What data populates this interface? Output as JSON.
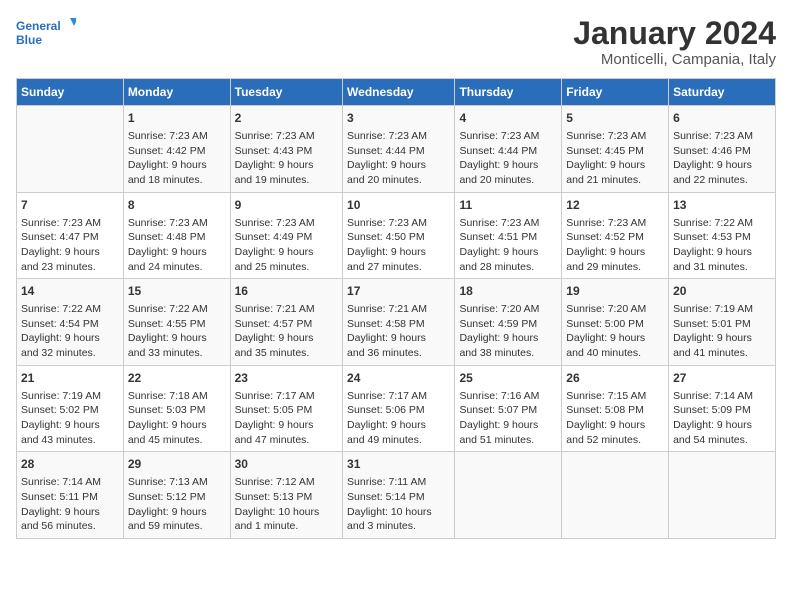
{
  "logo": {
    "line1": "General",
    "line2": "Blue"
  },
  "title": "January 2024",
  "subtitle": "Monticelli, Campania, Italy",
  "days_header": [
    "Sunday",
    "Monday",
    "Tuesday",
    "Wednesday",
    "Thursday",
    "Friday",
    "Saturday"
  ],
  "weeks": [
    [
      {
        "day": "",
        "info": ""
      },
      {
        "day": "1",
        "info": "Sunrise: 7:23 AM\nSunset: 4:42 PM\nDaylight: 9 hours\nand 18 minutes."
      },
      {
        "day": "2",
        "info": "Sunrise: 7:23 AM\nSunset: 4:43 PM\nDaylight: 9 hours\nand 19 minutes."
      },
      {
        "day": "3",
        "info": "Sunrise: 7:23 AM\nSunset: 4:44 PM\nDaylight: 9 hours\nand 20 minutes."
      },
      {
        "day": "4",
        "info": "Sunrise: 7:23 AM\nSunset: 4:44 PM\nDaylight: 9 hours\nand 20 minutes."
      },
      {
        "day": "5",
        "info": "Sunrise: 7:23 AM\nSunset: 4:45 PM\nDaylight: 9 hours\nand 21 minutes."
      },
      {
        "day": "6",
        "info": "Sunrise: 7:23 AM\nSunset: 4:46 PM\nDaylight: 9 hours\nand 22 minutes."
      }
    ],
    [
      {
        "day": "7",
        "info": "Sunrise: 7:23 AM\nSunset: 4:47 PM\nDaylight: 9 hours\nand 23 minutes."
      },
      {
        "day": "8",
        "info": "Sunrise: 7:23 AM\nSunset: 4:48 PM\nDaylight: 9 hours\nand 24 minutes."
      },
      {
        "day": "9",
        "info": "Sunrise: 7:23 AM\nSunset: 4:49 PM\nDaylight: 9 hours\nand 25 minutes."
      },
      {
        "day": "10",
        "info": "Sunrise: 7:23 AM\nSunset: 4:50 PM\nDaylight: 9 hours\nand 27 minutes."
      },
      {
        "day": "11",
        "info": "Sunrise: 7:23 AM\nSunset: 4:51 PM\nDaylight: 9 hours\nand 28 minutes."
      },
      {
        "day": "12",
        "info": "Sunrise: 7:23 AM\nSunset: 4:52 PM\nDaylight: 9 hours\nand 29 minutes."
      },
      {
        "day": "13",
        "info": "Sunrise: 7:22 AM\nSunset: 4:53 PM\nDaylight: 9 hours\nand 31 minutes."
      }
    ],
    [
      {
        "day": "14",
        "info": "Sunrise: 7:22 AM\nSunset: 4:54 PM\nDaylight: 9 hours\nand 32 minutes."
      },
      {
        "day": "15",
        "info": "Sunrise: 7:22 AM\nSunset: 4:55 PM\nDaylight: 9 hours\nand 33 minutes."
      },
      {
        "day": "16",
        "info": "Sunrise: 7:21 AM\nSunset: 4:57 PM\nDaylight: 9 hours\nand 35 minutes."
      },
      {
        "day": "17",
        "info": "Sunrise: 7:21 AM\nSunset: 4:58 PM\nDaylight: 9 hours\nand 36 minutes."
      },
      {
        "day": "18",
        "info": "Sunrise: 7:20 AM\nSunset: 4:59 PM\nDaylight: 9 hours\nand 38 minutes."
      },
      {
        "day": "19",
        "info": "Sunrise: 7:20 AM\nSunset: 5:00 PM\nDaylight: 9 hours\nand 40 minutes."
      },
      {
        "day": "20",
        "info": "Sunrise: 7:19 AM\nSunset: 5:01 PM\nDaylight: 9 hours\nand 41 minutes."
      }
    ],
    [
      {
        "day": "21",
        "info": "Sunrise: 7:19 AM\nSunset: 5:02 PM\nDaylight: 9 hours\nand 43 minutes."
      },
      {
        "day": "22",
        "info": "Sunrise: 7:18 AM\nSunset: 5:03 PM\nDaylight: 9 hours\nand 45 minutes."
      },
      {
        "day": "23",
        "info": "Sunrise: 7:17 AM\nSunset: 5:05 PM\nDaylight: 9 hours\nand 47 minutes."
      },
      {
        "day": "24",
        "info": "Sunrise: 7:17 AM\nSunset: 5:06 PM\nDaylight: 9 hours\nand 49 minutes."
      },
      {
        "day": "25",
        "info": "Sunrise: 7:16 AM\nSunset: 5:07 PM\nDaylight: 9 hours\nand 51 minutes."
      },
      {
        "day": "26",
        "info": "Sunrise: 7:15 AM\nSunset: 5:08 PM\nDaylight: 9 hours\nand 52 minutes."
      },
      {
        "day": "27",
        "info": "Sunrise: 7:14 AM\nSunset: 5:09 PM\nDaylight: 9 hours\nand 54 minutes."
      }
    ],
    [
      {
        "day": "28",
        "info": "Sunrise: 7:14 AM\nSunset: 5:11 PM\nDaylight: 9 hours\nand 56 minutes."
      },
      {
        "day": "29",
        "info": "Sunrise: 7:13 AM\nSunset: 5:12 PM\nDaylight: 9 hours\nand 59 minutes."
      },
      {
        "day": "30",
        "info": "Sunrise: 7:12 AM\nSunset: 5:13 PM\nDaylight: 10 hours\nand 1 minute."
      },
      {
        "day": "31",
        "info": "Sunrise: 7:11 AM\nSunset: 5:14 PM\nDaylight: 10 hours\nand 3 minutes."
      },
      {
        "day": "",
        "info": ""
      },
      {
        "day": "",
        "info": ""
      },
      {
        "day": "",
        "info": ""
      }
    ]
  ]
}
